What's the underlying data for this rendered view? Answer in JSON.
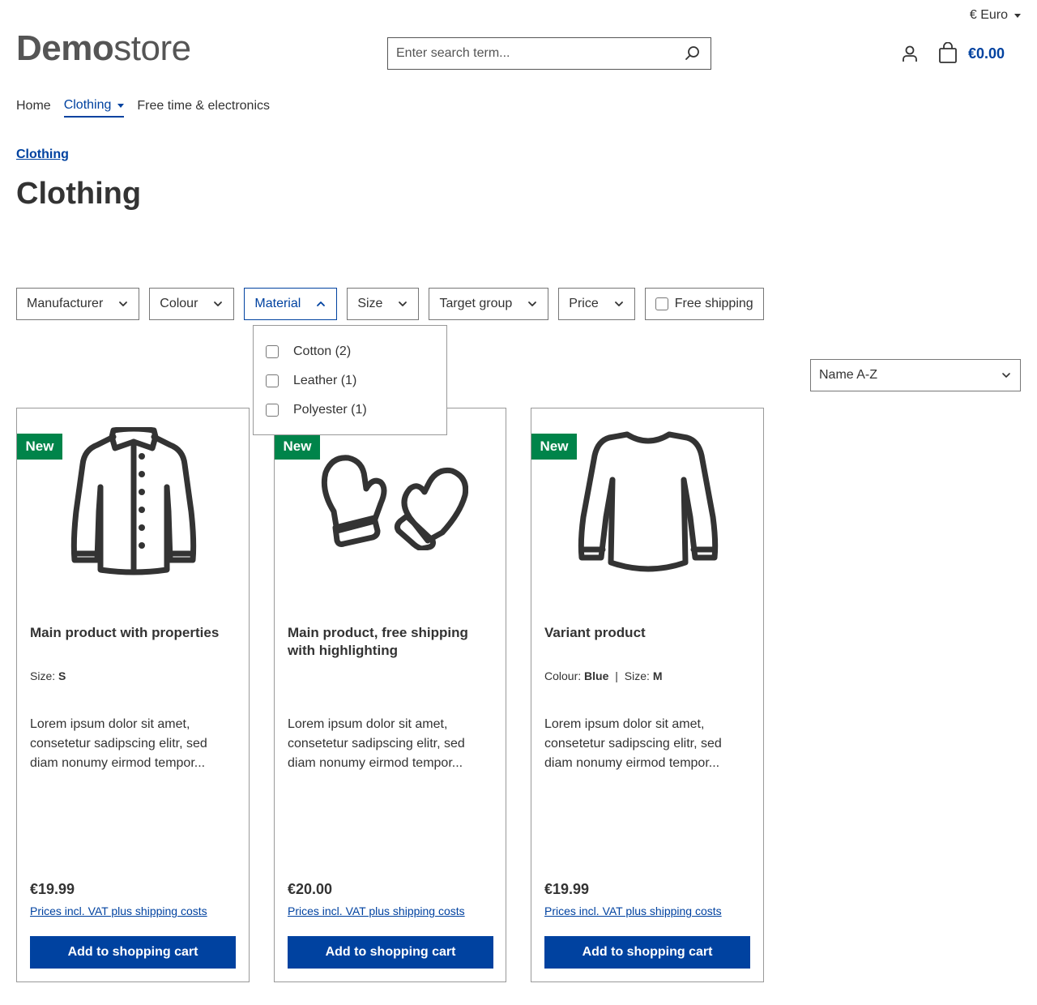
{
  "header": {
    "currency": "€ Euro",
    "logo_bold": "Demo",
    "logo_light": "store",
    "search_placeholder": "Enter search term...",
    "cart_total": "€0.00"
  },
  "nav": {
    "items": [
      {
        "label": "Home"
      },
      {
        "label": "Clothing"
      },
      {
        "label": "Free time & electronics"
      }
    ]
  },
  "breadcrumb": "Clothing",
  "page_title": "Clothing",
  "filters": {
    "manufacturer": "Manufacturer",
    "colour": "Colour",
    "material": "Material",
    "size": "Size",
    "target_group": "Target group",
    "price": "Price",
    "free_shipping": "Free shipping"
  },
  "material_options": [
    {
      "label": "Cotton (2)"
    },
    {
      "label": "Leather (1)"
    },
    {
      "label": "Polyester (1)"
    }
  ],
  "sort": "Name A-Z",
  "products": [
    {
      "badge": "New",
      "name": "Main product with properties",
      "prop1_label": "Size: ",
      "prop1_value": "S",
      "prop2_label": "",
      "prop2_value": "",
      "description": "Lorem ipsum dolor sit amet, consetetur sadipscing elitr, sed diam nonumy eirmod tempor...",
      "price": "€19.99",
      "vat": "Prices incl. VAT plus shipping costs",
      "button": "Add to shopping cart",
      "icon": "jacket-icon"
    },
    {
      "badge": "New",
      "name": "Main product, free shipping with highlighting",
      "prop1_label": "",
      "prop1_value": "",
      "prop2_label": "",
      "prop2_value": "",
      "description": "Lorem ipsum dolor sit amet, consetetur sadipscing elitr, sed diam nonumy eirmod tempor...",
      "price": "€20.00",
      "vat": "Prices incl. VAT plus shipping costs",
      "button": "Add to shopping cart",
      "icon": "mittens-icon"
    },
    {
      "badge": "New",
      "name": "Variant product",
      "prop1_label": "Colour: ",
      "prop1_value": "Blue",
      "prop2_label": "Size: ",
      "prop2_value": "M",
      "description": "Lorem ipsum dolor sit amet, consetetur sadipscing elitr, sed diam nonumy eirmod tempor...",
      "price": "€19.99",
      "vat": "Prices incl. VAT plus shipping costs",
      "button": "Add to shopping cart",
      "icon": "sweater-icon"
    }
  ],
  "colors": {
    "accent": "#0042a0",
    "badge": "#00844a",
    "text": "#333333"
  }
}
